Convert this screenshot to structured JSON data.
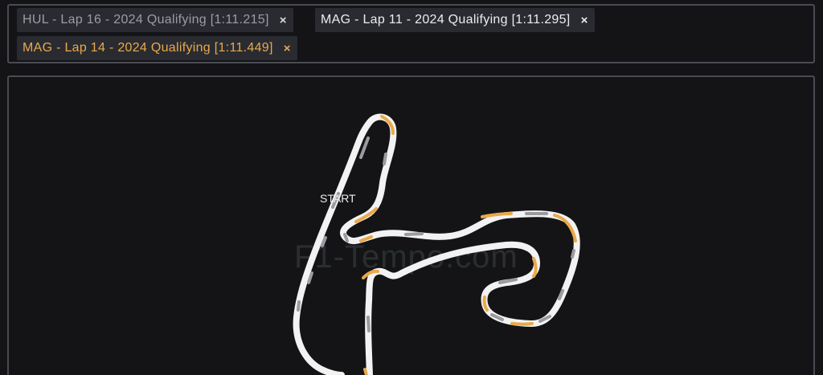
{
  "lap_tags": [
    {
      "label": "HUL - Lap 16 - 2024 Qualifying [1:11.215]",
      "close": "×",
      "color": "#9c9ca4"
    },
    {
      "label": "MAG - Lap 11 - 2024 Qualifying [1:11.295]",
      "close": "×",
      "color": "#ececf0"
    },
    {
      "label": "MAG - Lap 14 - 2024 Qualifying [1:11.449]",
      "close": "×",
      "color": "#e9a94a"
    }
  ],
  "track_map": {
    "start_label": "START",
    "watermark": "F1-Tempo.com",
    "colors": {
      "track": "#f2f2f2",
      "sector_grey": "#9a9aa0",
      "sector_orange": "#e9a94a",
      "background": "#141417"
    }
  }
}
